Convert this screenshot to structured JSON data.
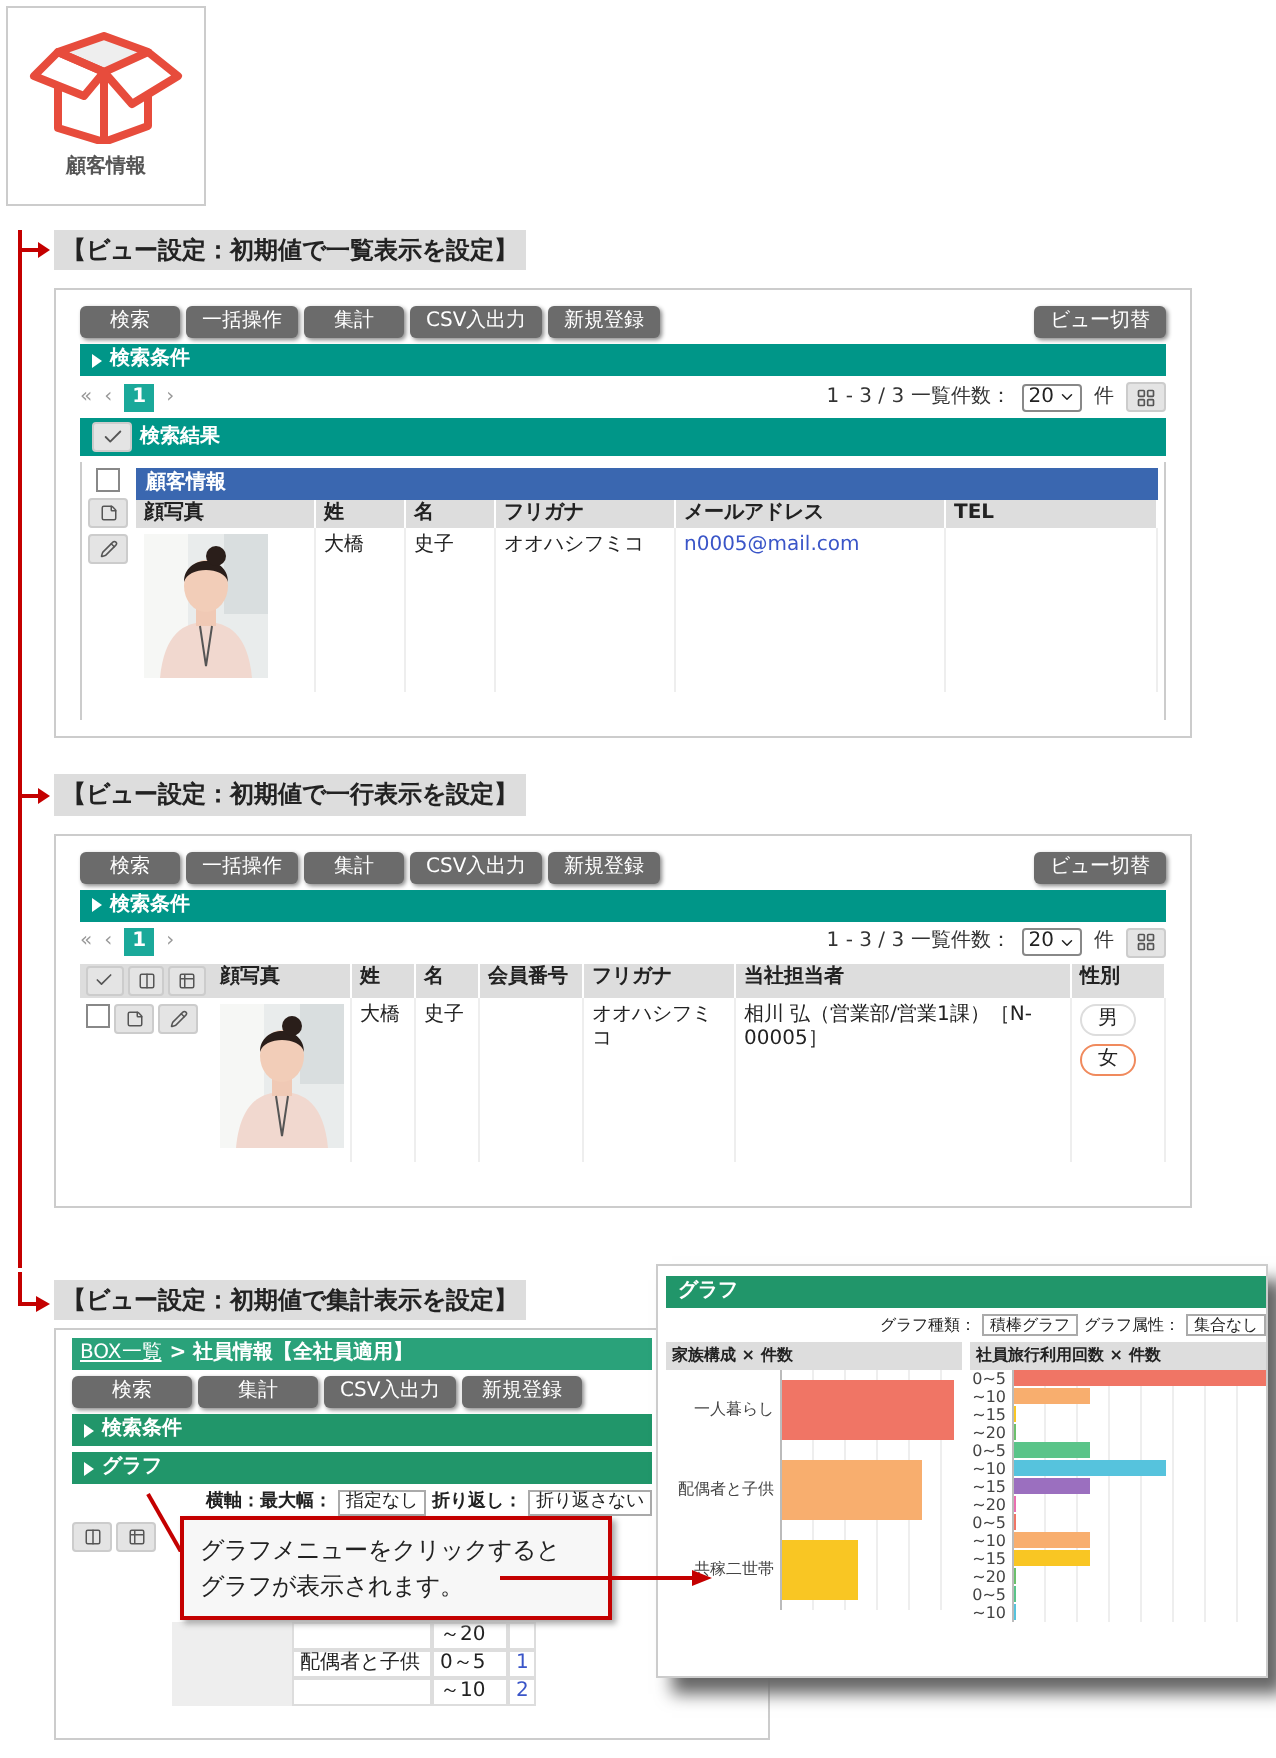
{
  "app_tile": {
    "label": "顧客情報"
  },
  "sections": [
    {
      "kind": "list",
      "heading": "【ビュー設定：初期値で一覧表示を設定】",
      "toolbar": {
        "buttons": [
          "検索",
          "一括操作",
          "集計",
          "CSV入出力",
          "新規登録"
        ],
        "view_button": "ビュー切替"
      },
      "search_bar": "検索条件",
      "pager": {
        "first": "«",
        "prev": "‹",
        "pages": [
          {
            "label": "1",
            "selected": true
          }
        ],
        "next": "›",
        "summary": "1 - 3 / 3 一覧件数：",
        "page_size": "20",
        "unit": "件"
      },
      "results_bar": "検索結果",
      "table": {
        "group": "顧客情報",
        "columns": [
          "顔写真",
          "姓",
          "名",
          "フリガナ",
          "メールアドレス",
          "TEL"
        ],
        "header_checked": false,
        "rows": [
          {
            "cells": [
              {
                "kind": "picture"
              },
              {
                "kind": "text",
                "text": "大橋"
              },
              {
                "kind": "text",
                "text": "史子"
              },
              {
                "kind": "text",
                "text": "オオハシフミコ"
              },
              {
                "kind": "link",
                "text": "n0005@mail.com"
              }
            ]
          }
        ]
      }
    },
    {
      "kind": "row",
      "heading": "【ビュー設定：初期値で一行表示を設定】",
      "toolbar": {
        "buttons": [
          "検索",
          "一括操作",
          "集計",
          "CSV入出力",
          "新規登録"
        ],
        "view_button": "ビュー切替"
      },
      "search_bar": "検索条件",
      "pager": {
        "first": "«",
        "prev": "‹",
        "pages": [
          {
            "label": "1",
            "selected": true
          }
        ],
        "next": "›",
        "summary": "1 - 3 / 3 一覧件数：",
        "page_size": "20",
        "unit": "件"
      },
      "table": {
        "columns": [
          "顔写真",
          "姓",
          "名",
          "会員番号",
          "フリガナ",
          "当社担当者",
          "性別"
        ],
        "rows": [
          {
            "checked": false,
            "cells": [
              {
                "kind": "picture"
              },
              {
                "kind": "text",
                "text": "大橋"
              },
              {
                "kind": "text",
                "text": "史子"
              },
              {
                "kind": "blank"
              },
              {
                "kind": "text",
                "text": "オオハシフミコ"
              },
              {
                "kind": "text",
                "text": "相川 弘（営業部/営業1課）［N-00005］"
              },
              {
                "kind": "choice",
                "options": [
                  {
                    "label": "男",
                    "selected": false
                  },
                  {
                    "label": "女",
                    "selected": true
                  }
                ]
              }
            ]
          }
        ]
      }
    }
  ],
  "summary_section": {
    "heading": "【ビュー設定：初期値で集計表示を設定】",
    "breadcrumb": {
      "link": "BOX一覧",
      "current": "> 社員情報【全社員適用】"
    },
    "toolbar": {
      "buttons": [
        "検索",
        "集計",
        "CSV入出力",
        "新規登録"
      ]
    },
    "bars": [
      "検索条件",
      "グラフ"
    ],
    "options": {
      "axis_label": "横軸：最大幅：",
      "axis_value": "指定なし",
      "wrap_label": "折り返し：",
      "wrap_value": "折り返さない"
    },
    "table": {
      "rows": [
        {
          "range": "～20"
        },
        {
          "category": "配偶者と子供",
          "range": "0～5",
          "count": "1"
        },
        {
          "range": "～10",
          "count": "2"
        }
      ]
    },
    "callout": {
      "lines": [
        "グラフメニューをクリックすると",
        "グラフが表示されます。"
      ]
    },
    "graph_panel": {
      "title": "グラフ",
      "type_label": "グラフ種類：",
      "type_value": "積棒グラフ",
      "attr_label": "グラフ属性：",
      "attr_value": "集合なし",
      "charts": [
        {
          "title": "家族構成 × 件数",
          "categories": [
            "一人暮らし",
            "配偶者と子供",
            "共稼二世帯"
          ]
        },
        {
          "title": "社員旅行利用回数 × 件数",
          "categories": [
            "0~5",
            "~10",
            "~15",
            "~20",
            "0~5",
            "~10",
            "~15",
            "~20",
            "0~5",
            "~10",
            "~15",
            "~20",
            "0~5",
            "~10"
          ]
        }
      ]
    }
  }
}
